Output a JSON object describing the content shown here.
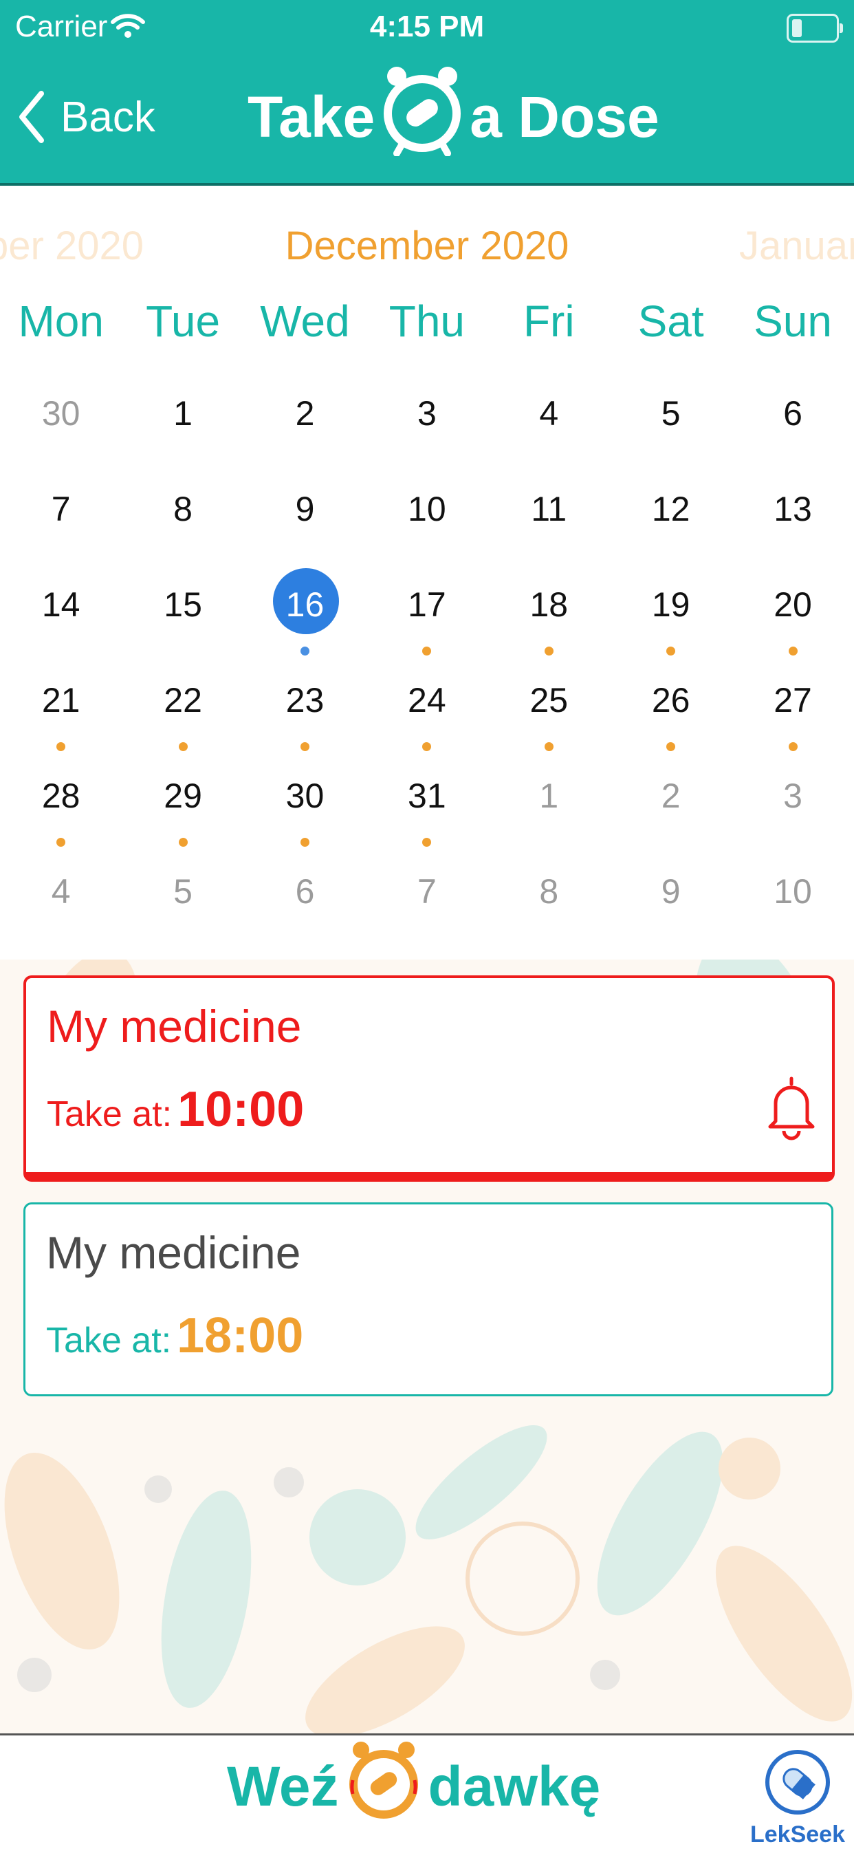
{
  "status_bar": {
    "carrier": "Carrier",
    "time": "4:15 PM"
  },
  "nav": {
    "back_label": "Back",
    "app_title_left": "Take",
    "app_title_right": "a Dose"
  },
  "calendar": {
    "prev_month": "ber 2020",
    "current_month": "December 2020",
    "next_month": "January",
    "weekdays": [
      "Mon",
      "Tue",
      "Wed",
      "Thu",
      "Fri",
      "Sat",
      "Sun"
    ],
    "weeks": [
      [
        {
          "d": "30",
          "other": true
        },
        {
          "d": "1"
        },
        {
          "d": "2"
        },
        {
          "d": "3"
        },
        {
          "d": "4"
        },
        {
          "d": "5"
        },
        {
          "d": "6"
        }
      ],
      [
        {
          "d": "7"
        },
        {
          "d": "8"
        },
        {
          "d": "9"
        },
        {
          "d": "10"
        },
        {
          "d": "11"
        },
        {
          "d": "12"
        },
        {
          "d": "13"
        }
      ],
      [
        {
          "d": "14"
        },
        {
          "d": "15"
        },
        {
          "d": "16",
          "selected": true,
          "dot": "blue"
        },
        {
          "d": "17",
          "dot": "orange"
        },
        {
          "d": "18",
          "dot": "orange"
        },
        {
          "d": "19",
          "dot": "orange"
        },
        {
          "d": "20",
          "dot": "orange"
        }
      ],
      [
        {
          "d": "21",
          "dot": "orange"
        },
        {
          "d": "22",
          "dot": "orange"
        },
        {
          "d": "23",
          "dot": "orange"
        },
        {
          "d": "24",
          "dot": "orange"
        },
        {
          "d": "25",
          "dot": "orange"
        },
        {
          "d": "26",
          "dot": "orange"
        },
        {
          "d": "27",
          "dot": "orange"
        }
      ],
      [
        {
          "d": "28",
          "dot": "orange"
        },
        {
          "d": "29",
          "dot": "orange"
        },
        {
          "d": "30",
          "dot": "orange"
        },
        {
          "d": "31",
          "dot": "orange"
        },
        {
          "d": "1",
          "other": true
        },
        {
          "d": "2",
          "other": true
        },
        {
          "d": "3",
          "other": true
        }
      ],
      [
        {
          "d": "4",
          "other": true
        },
        {
          "d": "5",
          "other": true
        },
        {
          "d": "6",
          "other": true
        },
        {
          "d": "7",
          "other": true
        },
        {
          "d": "8",
          "other": true
        },
        {
          "d": "9",
          "other": true
        },
        {
          "d": "10",
          "other": true
        }
      ]
    ]
  },
  "doses": [
    {
      "name": "My medicine",
      "take_label": "Take at:",
      "time": "10:00",
      "state": "due",
      "icon": "bell-icon"
    },
    {
      "name": "My medicine",
      "take_label": "Take at:",
      "time": "18:00",
      "state": "upcoming"
    }
  ],
  "footer": {
    "brand_left": "Weź",
    "brand_right": "dawkę",
    "partner": "LekSeek"
  },
  "colors": {
    "primary": "#18b6a8",
    "accent_orange": "#f0a030",
    "alert_red": "#ee1c1c",
    "selected_blue": "#2d7fe0"
  }
}
